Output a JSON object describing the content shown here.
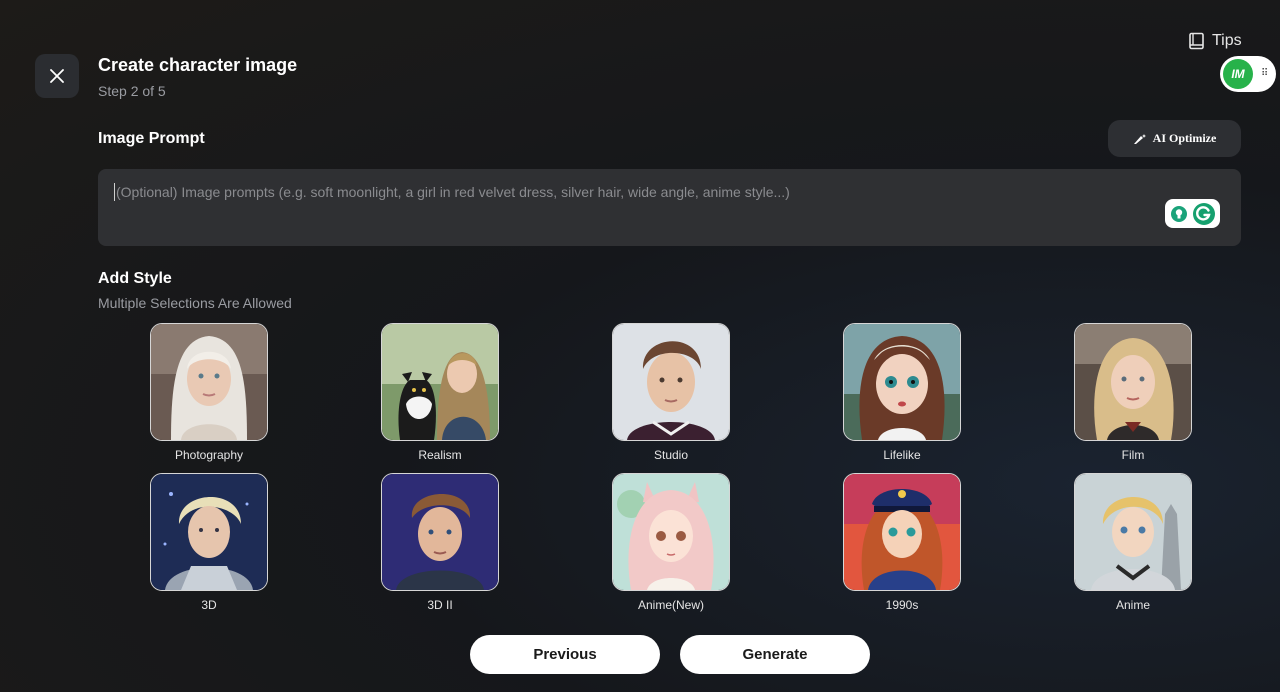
{
  "header": {
    "title": "Create character image",
    "step": "Step 2 of 5"
  },
  "tips": {
    "label": "Tips"
  },
  "badge": {
    "initials": "IM"
  },
  "prompt": {
    "label": "Image Prompt",
    "ai_optimize": "AI Optimize",
    "placeholder": "(Optional) Image prompts (e.g. soft moonlight, a girl in red velvet dress, silver hair, wide angle, anime style...)"
  },
  "style": {
    "label": "Add Style",
    "subtitle": "Multiple Selections Are Allowed",
    "items": [
      {
        "label": "Photography"
      },
      {
        "label": "Realism"
      },
      {
        "label": "Studio"
      },
      {
        "label": "Lifelike"
      },
      {
        "label": "Film"
      },
      {
        "label": "3D"
      },
      {
        "label": "3D II"
      },
      {
        "label": "Anime(New)"
      },
      {
        "label": "1990s"
      },
      {
        "label": "Anime"
      }
    ]
  },
  "footer": {
    "previous": "Previous",
    "generate": "Generate"
  }
}
